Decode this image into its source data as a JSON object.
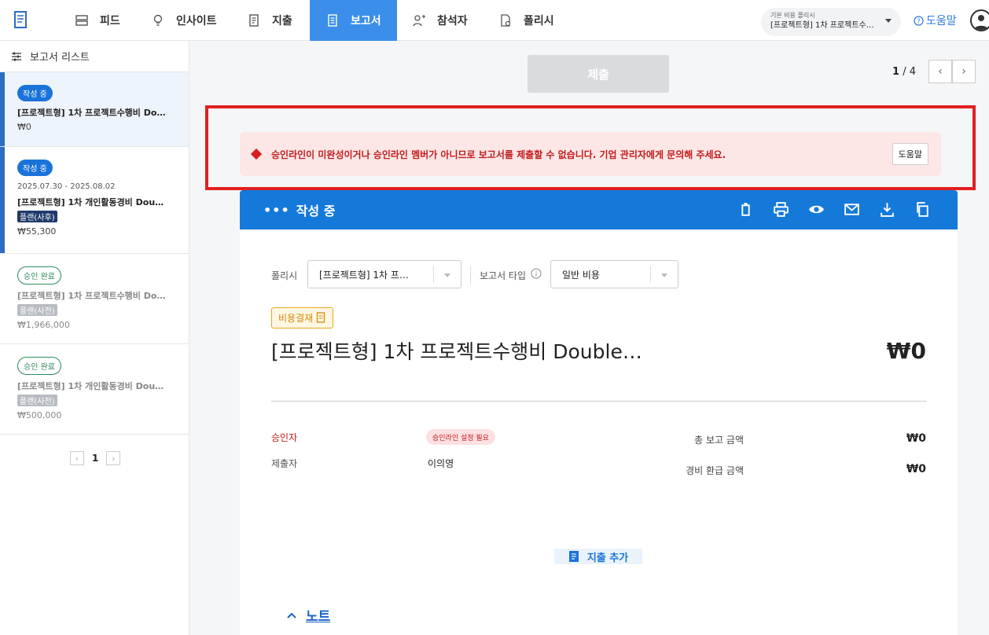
{
  "nav": {
    "items": [
      {
        "label": "피드",
        "icon": "feed-icon"
      },
      {
        "label": "인사이트",
        "icon": "lightbulb-icon"
      },
      {
        "label": "지출",
        "icon": "receipt-icon"
      },
      {
        "label": "보고서",
        "icon": "report-icon"
      },
      {
        "label": "참석자",
        "icon": "add-person-icon"
      },
      {
        "label": "폴리시",
        "icon": "policy-icon"
      }
    ],
    "active": "보고서",
    "policy_label": "기본 비용 폴리시",
    "policy_value": "[프로젝트형] 1차 프로젝트수…",
    "help": "도움말"
  },
  "sidebar": {
    "heading": "보고서 리스트",
    "cards": [
      {
        "status": "작성 중",
        "date": "",
        "title": "[프로젝트형] 1차 프로젝트수행비 Do…",
        "tag": "",
        "amount": "₩0"
      },
      {
        "status": "작성 중",
        "date": "2025.07.30 - 2025.08.02",
        "title": "[프로젝트형] 1차 개인활동경비 Dou…",
        "tag": "플랜(사후)",
        "amount": "₩55,300"
      },
      {
        "status": "승인 완료",
        "date": "",
        "title": "[프로젝트형] 1차 프로젝트수행비 Do…",
        "tag": "플랜(사전)",
        "amount": "₩1,966,000"
      },
      {
        "status": "승인 완료",
        "date": "",
        "title": "[프로젝트형] 1차 개인활동경비 Dou…",
        "tag": "플랜(사전)",
        "amount": "₩500,000"
      }
    ],
    "pager": {
      "prev": "‹",
      "page": "1",
      "next": "›"
    }
  },
  "main": {
    "submit": "제출",
    "page_current": "1",
    "page_total": "/ 4",
    "alert": "승인라인이 미완성이거나 승인라인 멤버가 아니므로 보고서를 제출할 수 없습니다. 기업 관리자에게 문의해 주세요.",
    "alert_help": "도움말"
  },
  "report": {
    "status": "작성 중",
    "dots": "•••",
    "policy_label": "폴리시",
    "policy_value": "[프로젝트형] 1차 프…",
    "type_label": "보고서 타입",
    "type_value": "일반 비용",
    "badge": "비용결재",
    "title": "[프로젝트형] 1차 프로젝트수행비 Double…",
    "amount": "₩0",
    "approver_label": "승인자",
    "approver_tag": "승인라인 설정 필요",
    "submitter_label": "제출자",
    "submitter_value": "이의영",
    "total_label": "총 보고 금액",
    "total_value": "₩0",
    "refund_label": "경비 환급 금액",
    "refund_value": "₩0",
    "add_expense": "지출 추가",
    "note": "노트"
  },
  "colors": {
    "primary": "#1479d9",
    "danger": "#c21c1c",
    "alert_bg": "#fde6e6",
    "highlight": "#e02020"
  }
}
